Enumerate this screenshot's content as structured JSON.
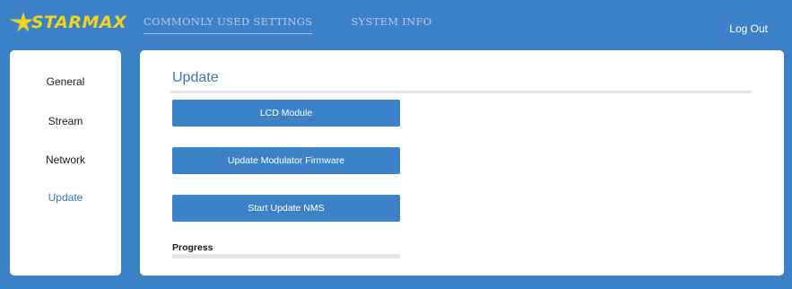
{
  "brand": {
    "name": "STARMAX",
    "accent_color": "#f2d21c"
  },
  "nav": {
    "tabs": [
      {
        "label": "COMMONLY USED SETTINGS",
        "active": true
      },
      {
        "label": "SYSTEM INFO",
        "active": false
      }
    ],
    "logout_label": "Log Out"
  },
  "sidebar": {
    "items": [
      {
        "label": "General",
        "active": false
      },
      {
        "label": "Stream",
        "active": false
      },
      {
        "label": "Network",
        "active": false
      },
      {
        "label": "Update",
        "active": true
      }
    ]
  },
  "main": {
    "title": "Update",
    "buttons": [
      {
        "label": "LCD Module"
      },
      {
        "label": "Update Modulator Firmware"
      },
      {
        "label": "Start Update NMS"
      }
    ],
    "progress": {
      "label": "Progress",
      "value": 0
    }
  },
  "colors": {
    "background": "#3c82c8",
    "panel": "#ffffff",
    "active_text": "#3a76bf"
  }
}
